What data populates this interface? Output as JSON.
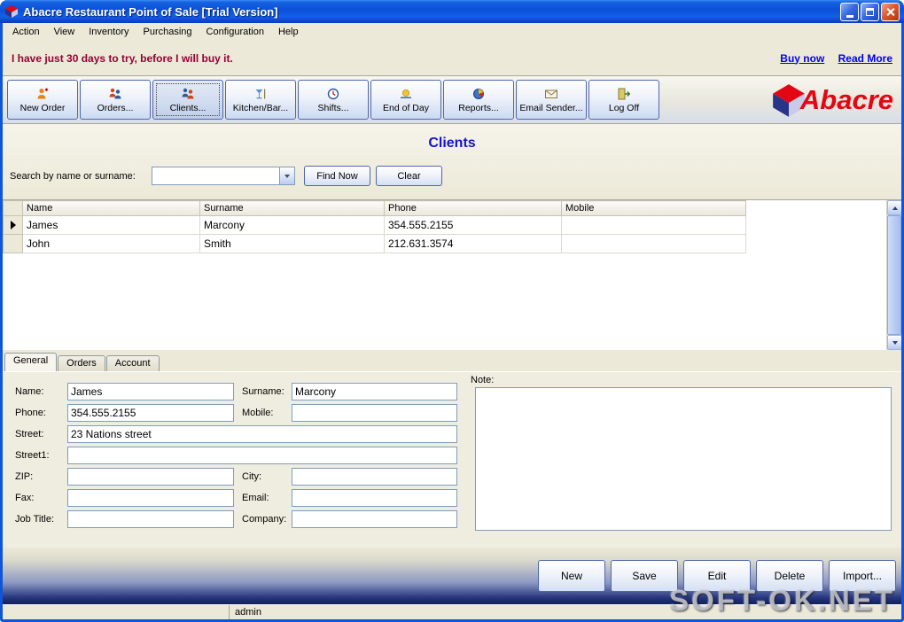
{
  "window": {
    "title": "Abacre Restaurant Point of Sale [Trial Version]",
    "controls": [
      "minimize-icon",
      "maximize-icon",
      "close-icon"
    ]
  },
  "menu": {
    "items": [
      "Action",
      "View",
      "Inventory",
      "Purchasing",
      "Configuration",
      "Help"
    ]
  },
  "trial": {
    "message": "I have just 30 days to try, before I will buy it.",
    "buy_link": "Buy now",
    "read_link": "Read More"
  },
  "toolbar": {
    "buttons": [
      {
        "label": "New Order",
        "icon": "new-order-icon"
      },
      {
        "label": "Orders...",
        "icon": "orders-icon"
      },
      {
        "label": "Clients...",
        "icon": "clients-icon",
        "active": true
      },
      {
        "label": "Kitchen/Bar...",
        "icon": "kitchen-bar-icon"
      },
      {
        "label": "Shifts...",
        "icon": "shifts-icon"
      },
      {
        "label": "End of Day",
        "icon": "end-of-day-icon"
      },
      {
        "label": "Reports...",
        "icon": "reports-icon"
      },
      {
        "label": "Email Sender...",
        "icon": "email-sender-icon"
      },
      {
        "label": "Log Off",
        "icon": "log-off-icon"
      }
    ],
    "logo_text": "Abacre"
  },
  "page": {
    "title": "Clients"
  },
  "search": {
    "label": "Search by name or surname:",
    "combo_value": "",
    "find_button": "Find Now",
    "clear_button": "Clear"
  },
  "table": {
    "columns": [
      "Name",
      "Surname",
      "Phone",
      "Mobile"
    ],
    "rows": [
      {
        "name": "James",
        "surname": "Marcony",
        "phone": "354.555.2155",
        "mobile": "",
        "selected": true
      },
      {
        "name": "John",
        "surname": "Smith",
        "phone": "212.631.3574",
        "mobile": "",
        "selected": false
      }
    ]
  },
  "tabs": [
    {
      "label": "General",
      "active": true
    },
    {
      "label": "Orders",
      "active": false
    },
    {
      "label": "Account",
      "active": false
    }
  ],
  "form": {
    "name": {
      "label": "Name:",
      "value": "James"
    },
    "phone": {
      "label": "Phone:",
      "value": "354.555.2155"
    },
    "street": {
      "label": "Street:",
      "value": "23 Nations street"
    },
    "street1": {
      "label": "Street1:",
      "value": ""
    },
    "zip": {
      "label": "ZIP:",
      "value": ""
    },
    "fax": {
      "label": "Fax:",
      "value": ""
    },
    "job_title": {
      "label": "Job Title:",
      "value": ""
    },
    "surname": {
      "label": "Surname:",
      "value": "Marcony"
    },
    "mobile": {
      "label": "Mobile:",
      "value": ""
    },
    "city": {
      "label": "City:",
      "value": ""
    },
    "email": {
      "label": "Email:",
      "value": ""
    },
    "company": {
      "label": "Company:",
      "value": ""
    },
    "note_label": "Note:",
    "note_value": ""
  },
  "actions": [
    "New",
    "Save",
    "Edit",
    "Delete",
    "Import..."
  ],
  "status": {
    "user": "admin"
  },
  "watermark": "SOFT-OK.NET",
  "colors": {
    "titlebar_blue": "#0F55D8",
    "page_title_blue": "#1414CC",
    "trial_message_red": "#990033",
    "link_blue": "#0000EE",
    "logo_red": "#E30613",
    "panel_beige": "#ECE9D8",
    "input_border": "#7F9DB9",
    "button_border": "#4E66B0"
  }
}
